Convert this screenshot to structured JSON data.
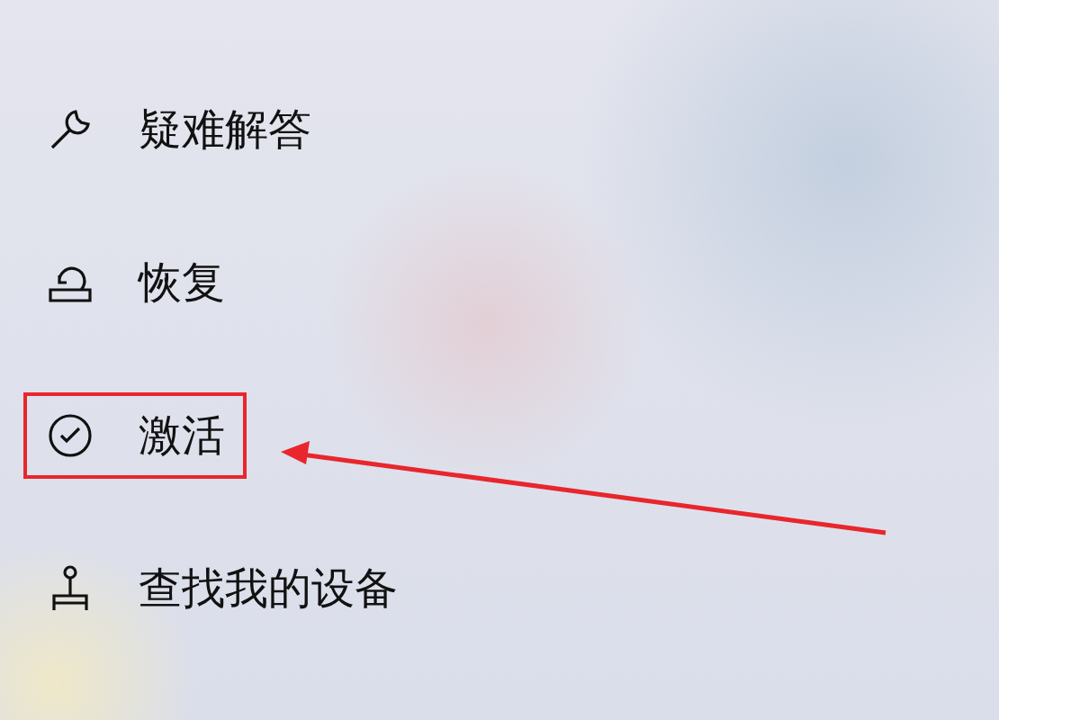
{
  "sidebar": {
    "items": [
      {
        "label": "疑难解答",
        "kind": "wrench",
        "selected": false
      },
      {
        "label": "恢复",
        "kind": "recovery",
        "selected": false
      },
      {
        "label": "激活",
        "kind": "check",
        "selected": true
      },
      {
        "label": "查找我的设备",
        "kind": "person",
        "selected": false
      }
    ]
  }
}
